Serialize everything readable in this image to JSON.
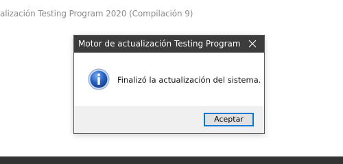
{
  "background_window": {
    "title": "alización Testing Program 2020 (Compilación 9)"
  },
  "dialog": {
    "title": "Motor de actualización Testing Program",
    "close_icon": "close-icon",
    "icon": "info-icon",
    "message": "Finalizó la actualización del sistema.",
    "accept_label": "Aceptar"
  },
  "colors": {
    "titlebar": "#3c3c3c",
    "footer": "#f0f0f0",
    "button_focus_border": "#0078d7",
    "info_icon_blue": "#1d59b8"
  }
}
